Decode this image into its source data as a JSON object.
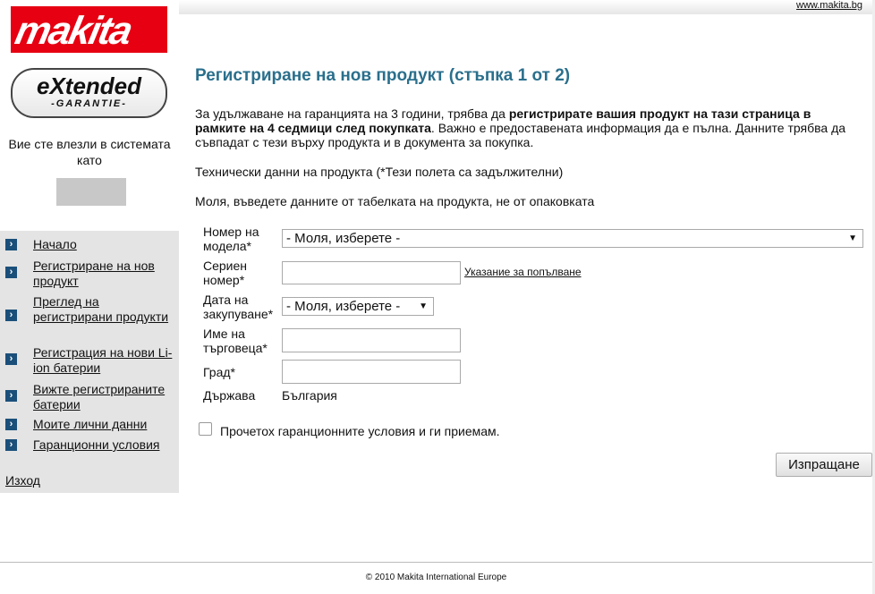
{
  "header": {
    "site_link": "www.makita.bg"
  },
  "branding": {
    "logo": "makita",
    "extended_main": "eXtended",
    "extended_sub": "-GARANTIE-"
  },
  "user": {
    "logged_in_text": "Вие сте влезли в системата като"
  },
  "nav": {
    "items": [
      {
        "label": "Начало"
      },
      {
        "label": "Регистриране на нов продукт"
      },
      {
        "label": "Преглед на регистрирани продукти"
      },
      {
        "label": "Регистрация на нови Li-ion батерии"
      },
      {
        "label": "Вижте регистрираните батерии"
      },
      {
        "label": "Моите лични данни"
      },
      {
        "label": "Гаранционни условия"
      }
    ],
    "logout": "Изход"
  },
  "main": {
    "title": "Регистриране на нов продукт (стъпка 1 от 2)",
    "intro_1": "За удължаване на гаранцията на 3 години, трябва да ",
    "intro_bold": "регистрирате вашия продукт на тази страница в рамките на 4 седмици след покупката",
    "intro_2": ". Важно е предоставената информация да е пълна. Данните трябва да съвпадат с тези върху продукта и в документа за покупка.",
    "tech_text": "Технически данни на продукта (*Тези полета са задължителни)",
    "please_text": "Моля, въведете данните от табелката на продукта, не от опаковката"
  },
  "form": {
    "model_label": "Номер на модела*",
    "model_value": "- Моля, изберете -",
    "serial_label": "Сериен номер*",
    "serial_hint": "Указание за попълване",
    "date_label": "Дата на закупуване*",
    "date_value": "- Моля, изберете -",
    "dealer_label": "Име на търговеца*",
    "city_label": "Град*",
    "country_label": "Държава",
    "country_value": "България",
    "accept_text": "Прочетох гаранционните условия и ги приемам.",
    "submit_label": "Изпращане"
  },
  "footer": {
    "copyright": "© 2010 Makita International Europe"
  }
}
